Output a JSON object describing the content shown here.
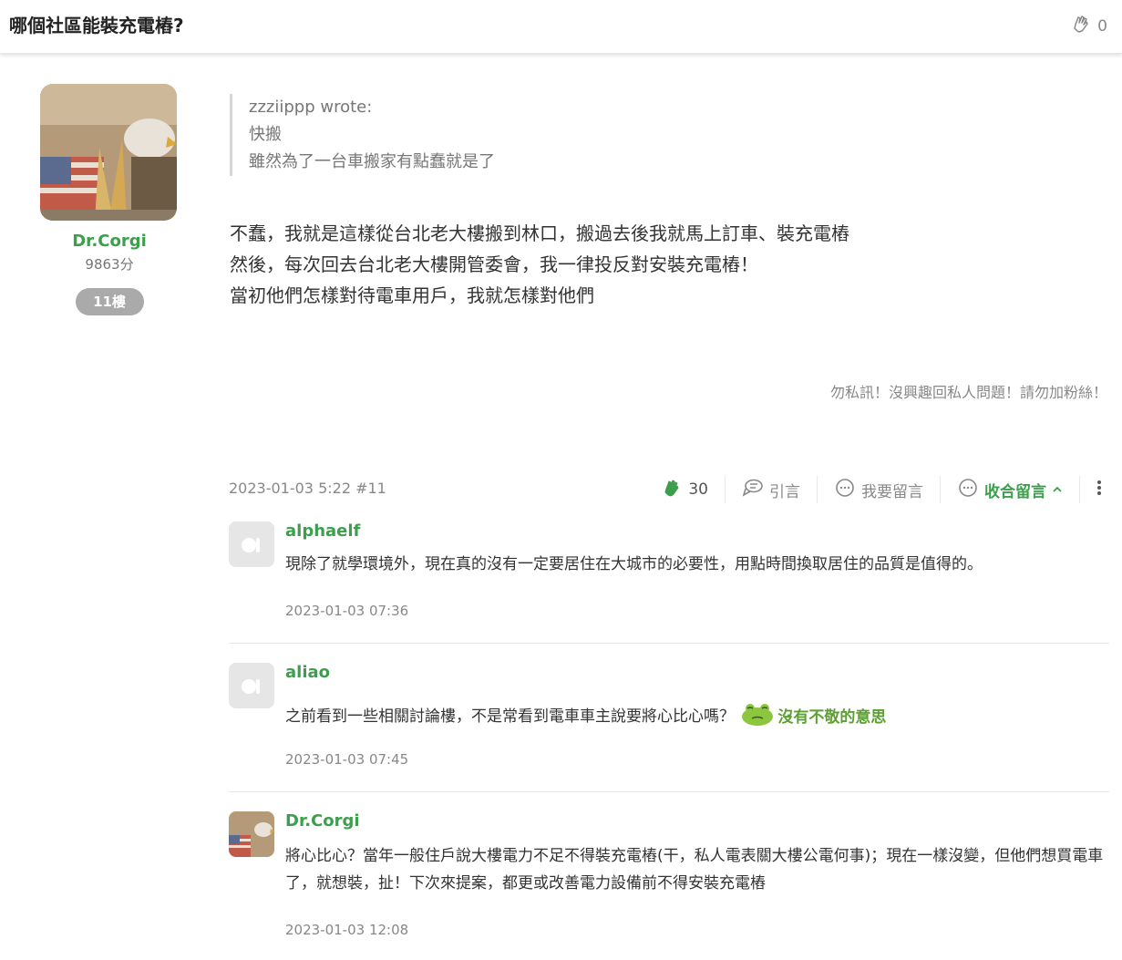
{
  "header": {
    "title": "哪個社區能裝充電樁?",
    "clap_count": "0"
  },
  "author": {
    "name": "Dr.Corgi",
    "score": "9863分",
    "floor": "11樓"
  },
  "quote": {
    "author_line": "zzziippp wrote:",
    "lines": [
      "快搬",
      "雖然為了一台車搬家有點蠢就是了"
    ]
  },
  "body": {
    "lines": [
      "不蠢，我就是這樣從台北老大樓搬到林口，搬過去後我就馬上訂車、裝充電樁",
      "然後，每次回去台北老大樓開管委會，我一律投反對安裝充電樁！",
      "當初他們怎樣對待電車用戶，我就怎樣對他們"
    ]
  },
  "signature": "勿私訊！沒興趣回私人問題！請勿加粉絲！",
  "meta": {
    "date": "2023-01-03 5:22 #11"
  },
  "actions": {
    "likes": "30",
    "quote": "引言",
    "comment": "我要留言",
    "collapse": "收合留言"
  },
  "comments": [
    {
      "name": "alphaelf",
      "text": "現除了就學環境外，現在真的沒有一定要居住在大城市的必要性，用點時間換取居住的品質是值得的。",
      "time": "2023-01-03 07:36"
    },
    {
      "name": "aliao",
      "text": "之前看到一些相關討論樓，不是常看到電車車主說要將心比心嗎？",
      "emoji_text": "沒有不敬的意思",
      "time": "2023-01-03 07:45"
    },
    {
      "name": "Dr.Corgi",
      "text": "將心比心？當年一般住戶說大樓電力不足不得裝充電樁(干，私人電表關大樓公電何事)；現在一樣沒變，但他們想買電車了，就想裝，扯！下次來提案，都更或改善電力設備前不得安裝充電樁",
      "time": "2023-01-03 12:08"
    }
  ],
  "colors": {
    "accent_green": "#3d9e4d",
    "muted": "#888888",
    "badge_gray": "#aaaaaa"
  },
  "icons": [
    "clap-icon",
    "quote-icon",
    "comment-icon",
    "collapse-icon",
    "chevron-up-icon",
    "more-vertical-icon"
  ]
}
